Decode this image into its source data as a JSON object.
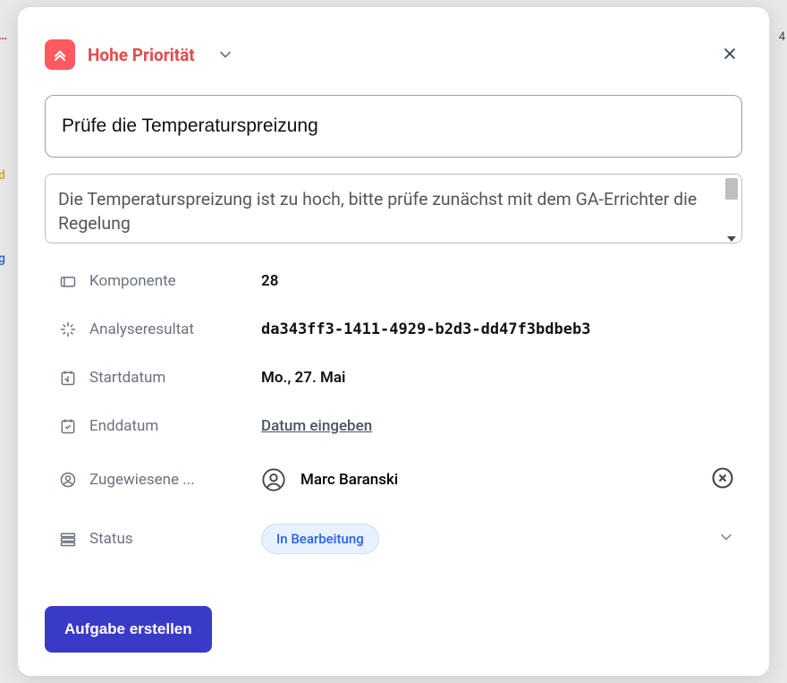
{
  "header": {
    "priority_label": "Hohe Priorität"
  },
  "form": {
    "title_value": "Prüfe die Temperaturspreizung",
    "description_value": "Die Temperaturspreizung ist zu hoch, bitte prüfe zunächst mit dem GA-Errichter die Regelung"
  },
  "fields": {
    "component": {
      "label": "Komponente",
      "value": "28"
    },
    "analysis": {
      "label": "Analyseresultat",
      "value": "da343ff3-1411-4929-b2d3-dd47f3bdbeb3"
    },
    "start_date": {
      "label": "Startdatum",
      "value": "Mo., 27. Mai"
    },
    "end_date": {
      "label": "Enddatum",
      "placeholder": "Datum eingeben"
    },
    "assignee": {
      "label": "Zugewiesene ...",
      "name": "Marc Baranski"
    },
    "status": {
      "label": "Status",
      "value": "In Bearbeitung"
    }
  },
  "actions": {
    "create_label": "Aufgabe erstellen"
  },
  "background_fragments": {
    "f1": "…",
    "f2": "d",
    "f3": "g",
    "f4": "4"
  }
}
